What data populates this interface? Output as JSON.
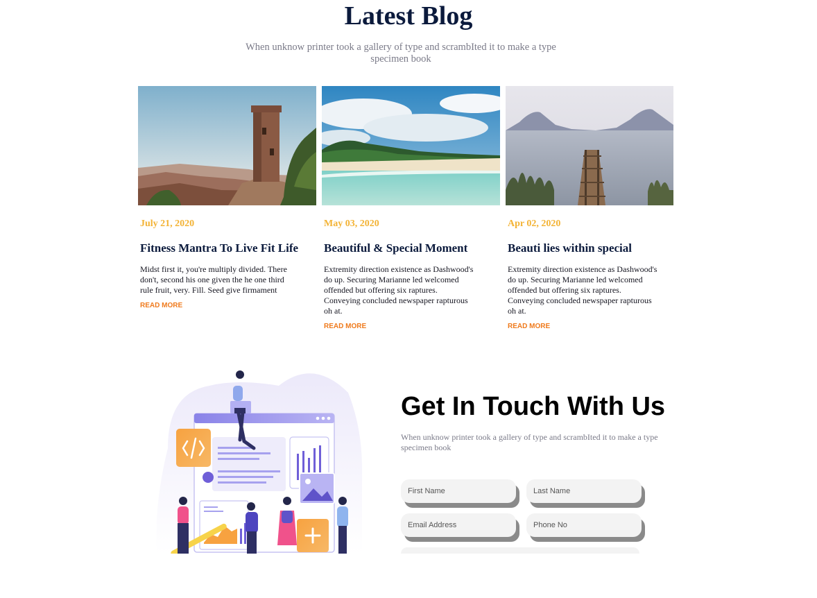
{
  "blog": {
    "title": "Latest Blog",
    "subtitle": "When unknow printer took a gallery of type and scrambIted it to make a type specimen book",
    "posts": [
      {
        "date": "July 21, 2020",
        "title": "Fitness Mantra To Live Fit Life",
        "excerpt": "Midst first it, you're multiply divided. There don't, second his one given the he one third rule fruit, very. Fill. Seed give firmament",
        "link": "READ MORE"
      },
      {
        "date": "May 03, 2020",
        "title": "Beautiful & Special Moment",
        "excerpt": "Extremity direction existence as Dashwood's do up. Securing Marianne led welcomed offended but offering six raptures. Conveying concluded newspaper rapturous oh at.",
        "link": "READ MORE"
      },
      {
        "date": "Apr 02, 2020",
        "title": "Beauti lies within special",
        "excerpt": "Extremity direction existence as Dashwood's do up. Securing Marianne led welcomed offended but offering six raptures. Conveying concluded newspaper rapturous oh at.",
        "link": "READ MORE"
      }
    ]
  },
  "contact": {
    "title": "Get In Touch With Us",
    "subtitle": "When unknow printer took a gallery of type and scrambIted it to make a type specimen book",
    "fields": {
      "first_name": "First Name",
      "last_name": "Last Name",
      "email": "Email Address",
      "phone": "Phone No"
    }
  },
  "colors": {
    "heading": "#0b1a3c",
    "date": "#f3b335",
    "link": "#ef7a1c",
    "muted": "#7a7a88"
  }
}
